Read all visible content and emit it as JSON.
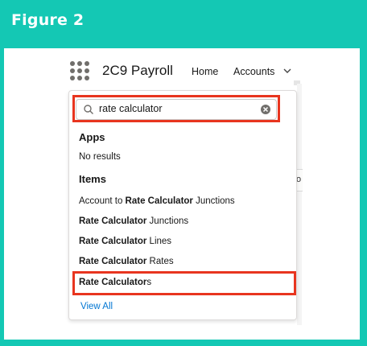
{
  "figure": {
    "title": "Figure 2"
  },
  "header": {
    "app_name": "2C9 Payroll",
    "nav": [
      "Home",
      "Accounts"
    ]
  },
  "search": {
    "value": "rate calculator"
  },
  "dropdown": {
    "apps_heading": "Apps",
    "apps_empty": "No results",
    "items_heading": "Items",
    "items": [
      {
        "prefix": "Account to ",
        "match": "Rate Calculator",
        "suffix": " Junctions"
      },
      {
        "prefix": "",
        "match": "Rate Calculator",
        "suffix": " Junctions"
      },
      {
        "prefix": "",
        "match": "Rate Calculator",
        "suffix": " Lines"
      },
      {
        "prefix": "",
        "match": "Rate Calculator",
        "suffix": " Rates"
      },
      {
        "prefix": "",
        "match": "Rate Calculator",
        "suffix": "s"
      }
    ],
    "view_all": "View All"
  },
  "background": {
    "partial_text": "o"
  },
  "colors": {
    "frame": "#14c8b4",
    "highlight": "#e8351f",
    "link": "#0176d3"
  }
}
